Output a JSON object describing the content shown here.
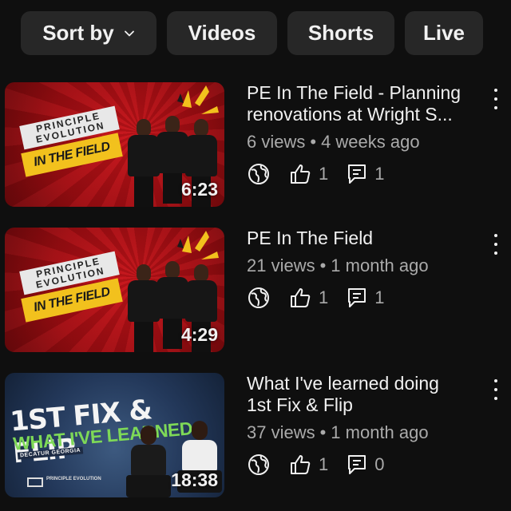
{
  "filters": {
    "sort_label": "Sort by",
    "videos_label": "Videos",
    "shorts_label": "Shorts",
    "live_label": "Live"
  },
  "videos": [
    {
      "title_line1": "PE In The Field - Planning",
      "title_line2": "renovations at Wright S...",
      "views": "6 views",
      "age": "4 weeks ago",
      "duration": "6:23",
      "likes": "1",
      "comments": "1",
      "thumb_text_1": "PRINCIPLE EVOLUTION",
      "thumb_text_2": "IN THE FIELD"
    },
    {
      "title_line1": "PE In The Field",
      "title_line2": "",
      "views": "21 views",
      "age": "1 month ago",
      "duration": "4:29",
      "likes": "1",
      "comments": "1",
      "thumb_text_1": "PRINCIPLE EVOLUTION",
      "thumb_text_2": "IN THE FIELD"
    },
    {
      "title_line1": "What I've learned doing",
      "title_line2": "1st Fix & Flip",
      "views": "37 views",
      "age": "1 month ago",
      "duration": "18:38",
      "likes": "1",
      "comments": "0",
      "thumb_text_1": "1ST FIX & FLIP",
      "thumb_text_2": "WHAT I'VE LEARNED",
      "thumb_text_3": "DECATUR GEORGIA",
      "thumb_text_4": "PRINCIPLE EVOLUTION"
    }
  ],
  "separator": "•",
  "icons": {
    "visibility": "globe-icon",
    "likes": "thumbs-up-icon",
    "comments": "comment-icon",
    "more": "more-vert-icon",
    "sort": "chevron-down-icon"
  },
  "colors": {
    "background": "#0f0f0f",
    "chip": "#272727",
    "text_primary": "#f1f1f1",
    "text_secondary": "#aaaaaa",
    "pe_yellow": "#f2c11d",
    "thumb_red": "#b3101a",
    "fix_green": "#7ed957"
  }
}
